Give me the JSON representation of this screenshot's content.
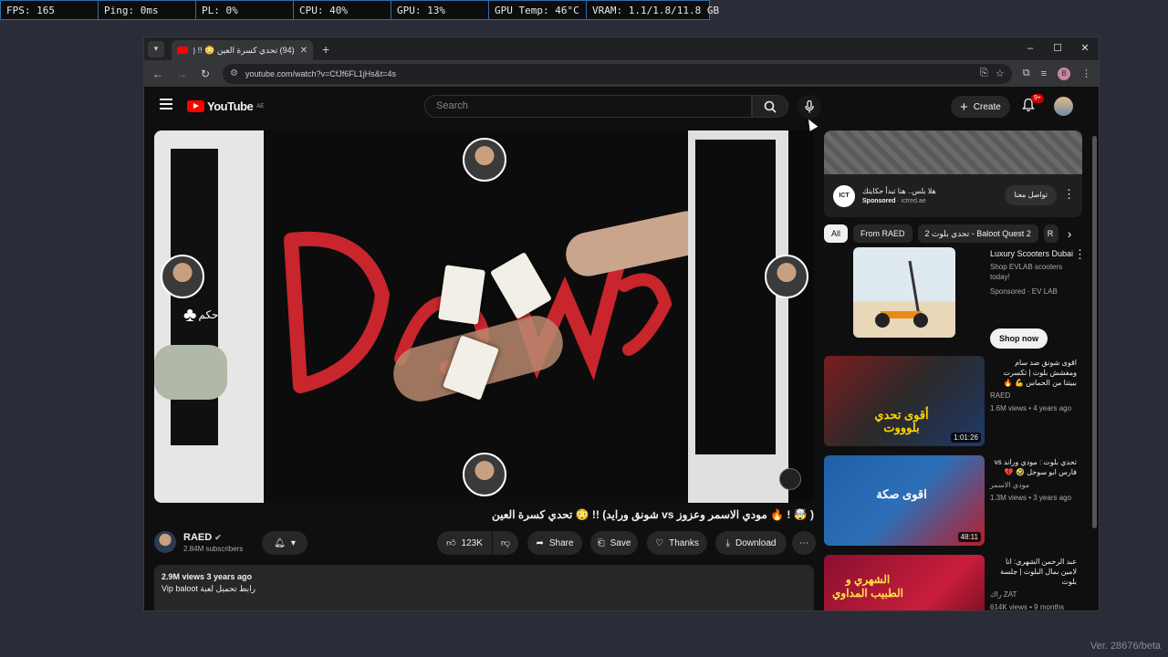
{
  "perf": {
    "fps": "FPS: 165",
    "ping": "Ping: 0ms",
    "pl": "PL: 0%",
    "cpu": "CPU: 40%",
    "gpu": "GPU: 13%",
    "gpu_temp": "GPU Temp: 46°C",
    "vram": "VRAM: 1.1/1.8/11.8 GB"
  },
  "version": "Ver. 28676/beta",
  "browser": {
    "tab_title": "(94) تحدي كسرة العين 😳 !! (شونق",
    "url": "youtube.com/watch?v=CfJf6FL1jHs&t=4s",
    "avatar_letter": "B"
  },
  "youtube": {
    "logo_text": "YouTube",
    "region": "AE",
    "search_placeholder": "Search",
    "create_label": "Create",
    "notif_count": "9+"
  },
  "video": {
    "title": "( 🤯 ! 🔥 مودي الاسمر وعزوز vs شونق ورايد) !! 😳 تحدي كسرة العين",
    "overlay_text": "حكم",
    "channel": "RAED",
    "subscribers": "2.84M subscribers",
    "likes": "123K",
    "share": "Share",
    "save": "Save",
    "thanks": "Thanks",
    "download": "Download",
    "views_date": "2.9M views  3 years ago",
    "desc_line": "Vip baloot رابط تحميل لعبة"
  },
  "ad": {
    "title": "هلا بلس.. هنا تبدأ حكايتك",
    "sponsor": "Sponsored",
    "domain": "ictred.ae",
    "cta": "تواصل معنا",
    "logo": "ICT"
  },
  "chips": [
    "All",
    "From RAED",
    "تحدي بلوت 2 - Baloot Quest 2",
    "R"
  ],
  "recs": [
    {
      "title": "Luxury Scooters Dubai",
      "line2": "Shop EVLAB scooters today!",
      "meta": "Sponsored · EV LAB",
      "button": "Shop now"
    },
    {
      "title": "اقوى شونق ضد سام ومفشش بلوت | تكسرت ببيتنا من الحماس 💪 🔥",
      "channel": "RAED",
      "meta": "1.6M views • 4 years ago",
      "duration": "1:01:26",
      "thumb_text": "أقوى تحدي بلوووت"
    },
    {
      "title": "تحدي بلوت : مودي وراند vs فارس ابو سوحل 🤣 💔",
      "channel": "مودي الاسمر",
      "meta": "1.3M views • 3 years ago",
      "duration": "48:11",
      "thumb_text": "اقوى صكة"
    },
    {
      "title": "عبد الرحمن الشهري: انا لامين بمال البلوت | جلسة بلوت",
      "channel": "راك ZAT",
      "meta": "614K views • 9 months ago",
      "thumb_text": "الشهري و الطبيب المداوي"
    }
  ]
}
